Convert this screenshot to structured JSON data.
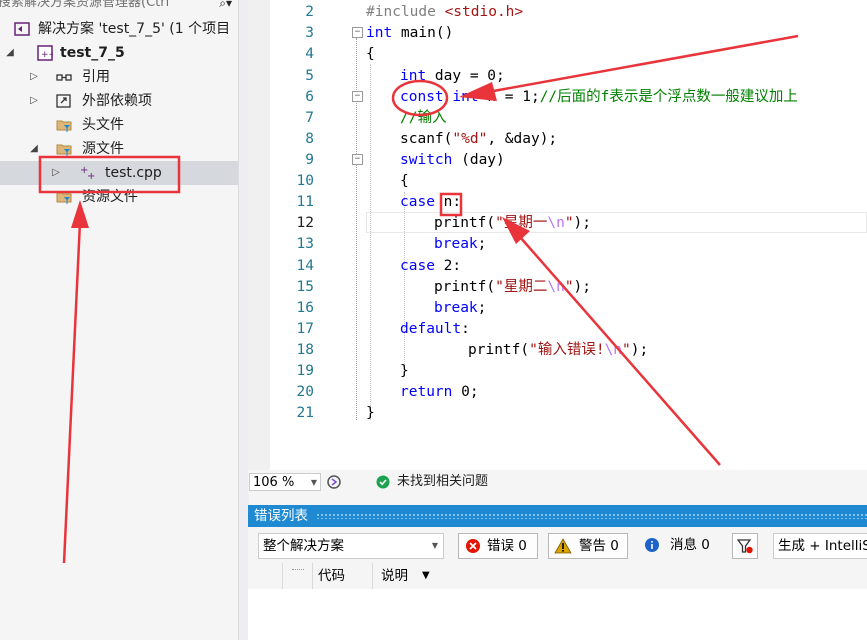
{
  "solution_explorer": {
    "search_placeholder": "搜索解决方案资源管理器(Ctrl",
    "search_icon": "search-icon",
    "solution_label": "解决方案 'test_7_5' (1 个项目",
    "project_label": "test_7_5",
    "items": [
      {
        "label": "引用",
        "icon": "references-icon"
      },
      {
        "label": "外部依赖项",
        "icon": "external-deps-icon"
      },
      {
        "label": "头文件",
        "icon": "filter-folder-icon"
      },
      {
        "label": "源文件",
        "icon": "filter-folder-icon"
      },
      {
        "label": "test.cpp",
        "icon": "cpp-file-icon"
      },
      {
        "label": "资源文件",
        "icon": "filter-folder-icon"
      }
    ]
  },
  "editor": {
    "line_numbers": [
      "2",
      "3",
      "4",
      "5",
      "6",
      "7",
      "8",
      "9",
      "10",
      "11",
      "12",
      "13",
      "14",
      "15",
      "16",
      "17",
      "18",
      "19",
      "20",
      "21"
    ],
    "current_line": "12",
    "code": {
      "l2_a": "#include ",
      "l2_b": "<stdio.h>",
      "l3_kw": "int",
      "l3_rest": " main()",
      "l4": "{",
      "l5_kw": "int",
      "l5_rest": " day = 0;",
      "l6_kw1": "const",
      "l6_kw2": "int",
      "l6_rest": " n = 1;",
      "l6_cm": "//后面的f表示是个浮点数一般建议加上",
      "l7_cm": "//输入",
      "l8_a": "scanf(",
      "l8_str": "\"%d\"",
      "l8_b": ", &day);",
      "l9_kw": "switch",
      "l9_rest": " (day)",
      "l10": "{",
      "l11_kw": "case",
      "l11_rest": " n:",
      "l12_a": "printf(",
      "l12_str1": "\"星期一",
      "l12_esc": "\\n",
      "l12_str2": "\"",
      "l12_b": ");",
      "l13_kw": "break",
      "l13_rest": ";",
      "l14_kw": "case",
      "l14_rest": " 2:",
      "l15_a": "printf(",
      "l15_str1": "\"星期二",
      "l15_esc": "\\n",
      "l15_str2": "\"",
      "l15_b": ");",
      "l16_kw": "break",
      "l16_rest": ";",
      "l17_kw": "default",
      "l17_rest": ":",
      "l18_a": "printf(",
      "l18_str1": "\"输入错误!",
      "l18_esc": "\\n",
      "l18_str2": "\"",
      "l18_b": ");",
      "l19": "}",
      "l20_kw": "return",
      "l20_rest": " 0;",
      "l21": "}"
    }
  },
  "status": {
    "zoom": "106 %",
    "issues_text": "未找到相关问题"
  },
  "error_list": {
    "title": "错误列表",
    "scope": "整个解决方案",
    "errors_label": "错误 0",
    "warnings_label": "警告 0",
    "messages_label": "消息 0",
    "build_filter": "生成 + IntelliSense",
    "col_code": "代码",
    "col_desc": "说明"
  },
  "colors": {
    "accent": "#1f8ad2",
    "annotation_red": "#e8343a",
    "keyword": "#0000ff",
    "string": "#a31515",
    "comment": "#008000"
  }
}
